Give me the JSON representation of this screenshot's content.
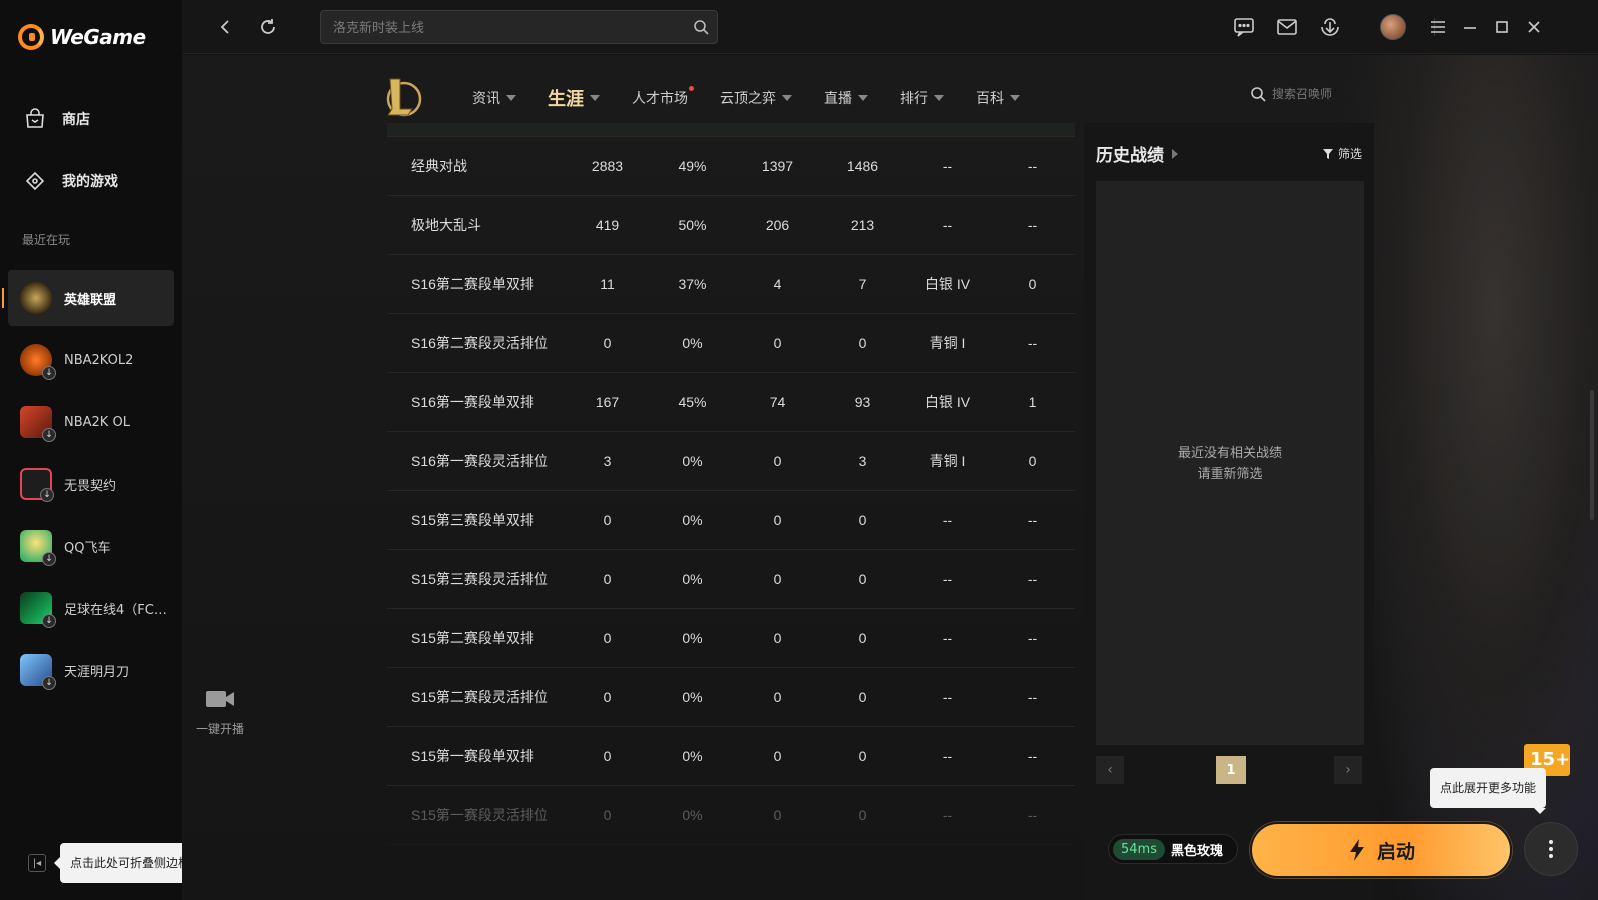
{
  "app": {
    "brand": "WeGame"
  },
  "sidebar": {
    "nav": [
      {
        "label": "商店",
        "icon": "store-icon"
      },
      {
        "label": "我的游戏",
        "icon": "my-games-icon"
      }
    ],
    "recent_title": "最近在玩",
    "games": [
      {
        "label": "英雄联盟",
        "active": true
      },
      {
        "label": "NBA2KOL2"
      },
      {
        "label": "NBA2K OL"
      },
      {
        "label": "无畏契约"
      },
      {
        "label": "QQ飞车"
      },
      {
        "label": "足球在线4（FC ..."
      },
      {
        "label": "天涯明月刀"
      }
    ],
    "collapse_tooltip": "点击此处可折叠侧边栏"
  },
  "topbar": {
    "search_placeholder": "洛克新时装上线"
  },
  "game_nav": {
    "tabs": [
      {
        "label": "资讯",
        "caret": true
      },
      {
        "label": "生涯",
        "caret": true,
        "active": true
      },
      {
        "label": "人才市场",
        "dot": true
      },
      {
        "label": "云顶之弈",
        "caret": true
      },
      {
        "label": "直播",
        "caret": true
      },
      {
        "label": "排行",
        "caret": true
      },
      {
        "label": "百科",
        "caret": true
      }
    ],
    "summoner_search": "搜索召唤师"
  },
  "stats": {
    "rows": [
      [
        "经典对战",
        "2883",
        "49%",
        "1397",
        "1486",
        "--",
        "--"
      ],
      [
        "极地大乱斗",
        "419",
        "50%",
        "206",
        "213",
        "--",
        "--"
      ],
      [
        "S16第二赛段单双排",
        "11",
        "37%",
        "4",
        "7",
        "白银 IV",
        "0"
      ],
      [
        "S16第二赛段灵活排位",
        "0",
        "0%",
        "0",
        "0",
        "青铜 I",
        "--"
      ],
      [
        "S16第一赛段单双排",
        "167",
        "45%",
        "74",
        "93",
        "白银 IV",
        "1"
      ],
      [
        "S16第一赛段灵活排位",
        "3",
        "0%",
        "0",
        "3",
        "青铜 I",
        "0"
      ],
      [
        "S15第三赛段单双排",
        "0",
        "0%",
        "0",
        "0",
        "--",
        "--"
      ],
      [
        "S15第三赛段灵活排位",
        "0",
        "0%",
        "0",
        "0",
        "--",
        "--"
      ],
      [
        "S15第二赛段单双排",
        "0",
        "0%",
        "0",
        "0",
        "--",
        "--"
      ],
      [
        "S15第二赛段灵活排位",
        "0",
        "0%",
        "0",
        "0",
        "--",
        "--"
      ],
      [
        "S15第一赛段单双排",
        "0",
        "0%",
        "0",
        "0",
        "--",
        "--"
      ],
      [
        "S15第一赛段灵活排位",
        "0",
        "0%",
        "0",
        "0",
        "--",
        "--"
      ]
    ]
  },
  "history": {
    "title": "历史战绩",
    "filter": "筛选",
    "empty_line1": "最近没有相关战绩",
    "empty_line2": "请重新筛选",
    "page": "1"
  },
  "live": {
    "label": "一键开播"
  },
  "launch": {
    "ping": "54ms",
    "server": "黑色玫瑰",
    "button": "启动",
    "more_tooltip": "点此展开更多功能",
    "age_rating": "15+"
  },
  "colors": {
    "accent": "#ff9a2e",
    "tab_active": "#f0d9a0",
    "ping": "#6ee09c"
  }
}
